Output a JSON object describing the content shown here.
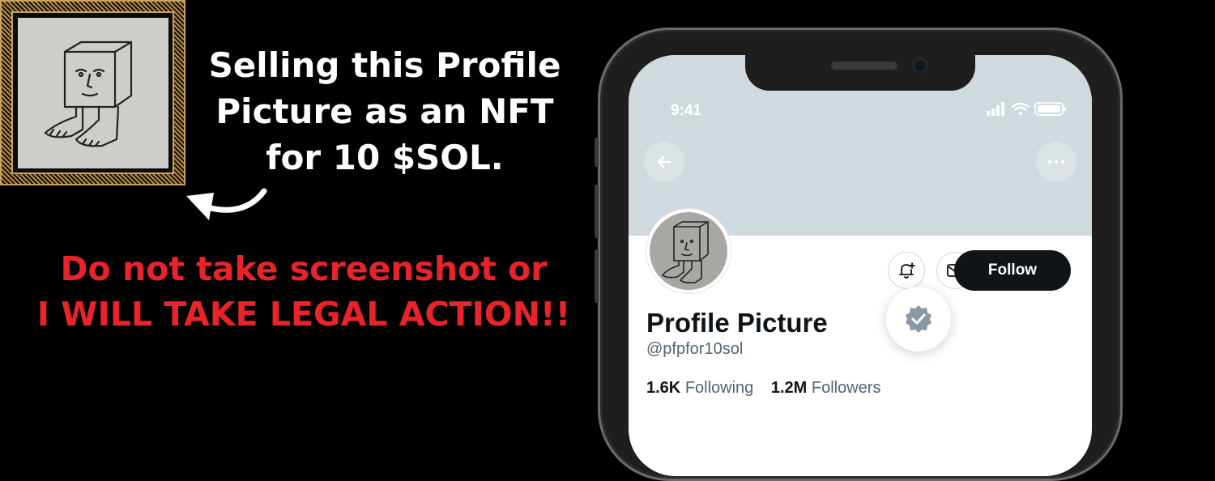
{
  "headline": {
    "line1": "Selling this Profile",
    "line2": "Picture as an NFT",
    "line3": "for 10 $SOL."
  },
  "warning": {
    "line1": "Do not take screenshot or",
    "line2": "I WILL TAKE LEGAL ACTION!!"
  },
  "colors": {
    "background": "#000000",
    "warning": "#e8232a",
    "banner": "#cfd9de",
    "follow_button": "#0f1419",
    "verified_badge": "#8b98a5"
  },
  "phone": {
    "status_bar": {
      "time": "9:41",
      "icons": [
        "signal-icon",
        "wifi-icon",
        "battery-icon"
      ]
    },
    "profile": {
      "name": "Profile Picture",
      "handle": "@pfpfor10sol",
      "following_count": "1.6K",
      "following_label": "Following",
      "followers_count": "1.2M",
      "followers_label": "Followers",
      "follow_button": "Follow",
      "action_icons": [
        "back-arrow-icon",
        "more-icon",
        "bell-plus-icon",
        "mail-icon",
        "verified-badge-icon"
      ]
    }
  }
}
